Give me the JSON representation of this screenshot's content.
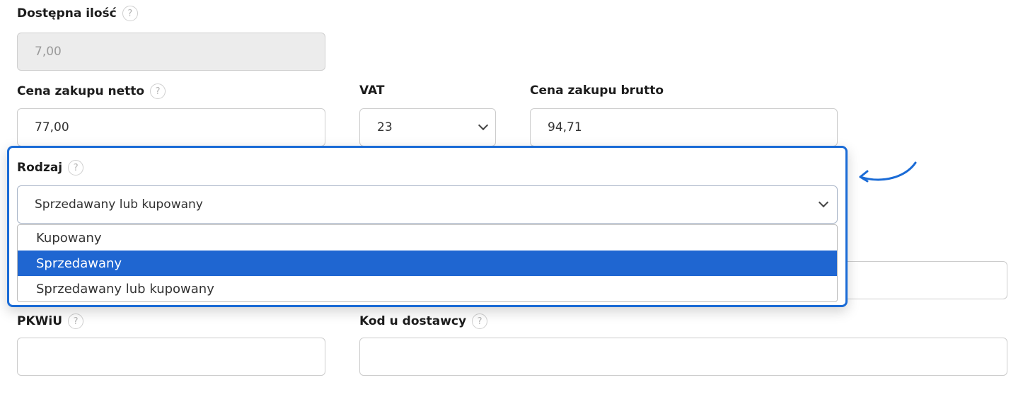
{
  "available_qty": {
    "label": "Dostępna ilość",
    "help": "?",
    "value": "7,00"
  },
  "net_price": {
    "label": "Cena zakupu netto",
    "help": "?",
    "value": "77,00"
  },
  "vat": {
    "label": "VAT",
    "value": "23"
  },
  "gross_price": {
    "label": "Cena zakupu brutto",
    "value": "94,71"
  },
  "type": {
    "label": "Rodzaj",
    "help": "?",
    "selected": "Sprzedawany lub kupowany",
    "options": [
      "Kupowany",
      "Sprzedawany",
      "Sprzedawany lub kupowany"
    ],
    "highlighted_option": "Sprzedawany"
  },
  "pkwiu": {
    "label": "PKWiU",
    "help": "?",
    "value": ""
  },
  "supplier_code": {
    "label": "Kod u dostawcy",
    "help": "?",
    "value": ""
  },
  "colors": {
    "accent": "#1a6bd6",
    "selected_option_bg": "#1f66d1",
    "disabled_bg": "#ececec"
  }
}
